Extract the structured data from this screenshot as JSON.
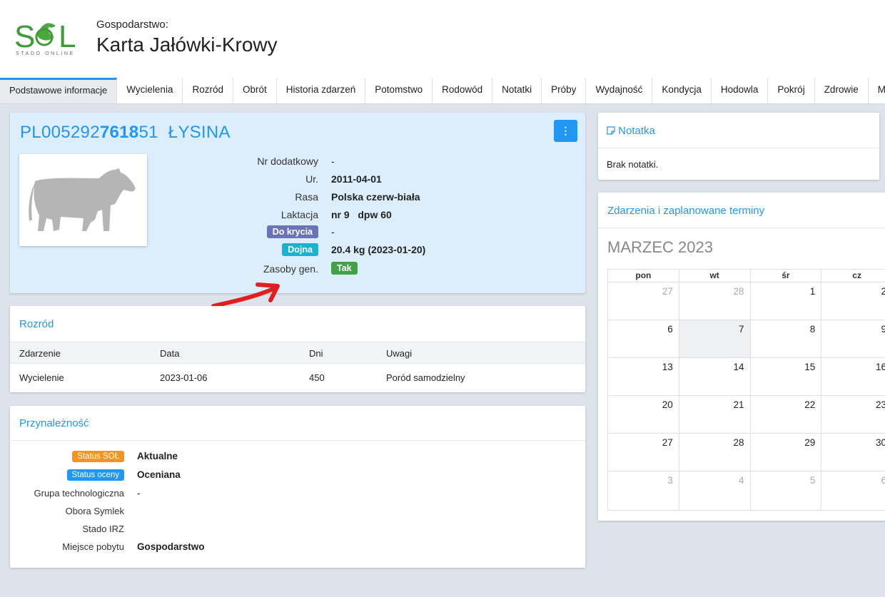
{
  "header": {
    "farm_label": "Gospodarstwo:",
    "title": "Karta Jałówki-Krowy",
    "logo_text": "STADO ONLINE",
    "logo_mark": "SOL"
  },
  "tabs": [
    "Podstawowe informacje",
    "Wycielenia",
    "Rozród",
    "Obrót",
    "Historia zdarzeń",
    "Potomstwo",
    "Rodowód",
    "Notatki",
    "Próby",
    "Wydajność",
    "Kondycja",
    "Hodowla",
    "Pokrój",
    "Zdrowie",
    "Mleko"
  ],
  "active_tab": "Podstawowe informacje",
  "cow": {
    "id_prefix": "PL005292",
    "id_bold": "7618",
    "id_suffix": "51",
    "name": "ŁYSINA",
    "menu_icon": "⋮",
    "fields": [
      {
        "label": "Nr dodatkowy",
        "value": "-"
      },
      {
        "label": "Ur.",
        "value": "2011-04-01"
      },
      {
        "label": "Rasa",
        "value": "Polska czerw-biała"
      },
      {
        "label": "Laktacja",
        "value": "nr 9   dpw 60"
      },
      {
        "label": "Do krycia",
        "value": "-",
        "badge_color": "#6b72b8"
      },
      {
        "label": "Dojna",
        "value": "20.4 kg (2023-01-20)",
        "badge_color": "#17b3d1"
      },
      {
        "label": "Zasoby gen.",
        "value": "Tak",
        "value_badge_color": "#43a047"
      }
    ]
  },
  "rozrod": {
    "title": "Rozród",
    "columns": [
      "Zdarzenie",
      "Data",
      "Dni",
      "Uwagi"
    ],
    "rows": [
      [
        "Wycielenie",
        "2023-01-06",
        "450",
        "Poród samodzielny"
      ]
    ]
  },
  "przynaleznosc": {
    "title": "Przynależność",
    "rows": [
      {
        "label": "Status SOŁ",
        "value": "Aktualne",
        "badge_color": "#f7941d"
      },
      {
        "label": "Status oceny",
        "value": "Oceniana",
        "badge_color": "#2196f3"
      },
      {
        "label": "Grupa technologiczna",
        "value": "-"
      },
      {
        "label": "Obora Symlek",
        "value": ""
      },
      {
        "label": "Stado IRZ",
        "value": ""
      },
      {
        "label": "Miejsce pobytu",
        "value": "Gospodarstwo"
      }
    ]
  },
  "notatka": {
    "title": "Notatka",
    "icon": "note-icon",
    "text": "Brak notatki."
  },
  "calendar": {
    "title": "Zdarzenia i zaplanowane terminy",
    "month": "MARZEC 2023",
    "weekdays": [
      "pon",
      "wt",
      "śr",
      "cz"
    ],
    "weeks": [
      [
        {
          "d": "27",
          "m": true
        },
        {
          "d": "28",
          "m": true
        },
        {
          "d": "1"
        },
        {
          "d": "2"
        }
      ],
      [
        {
          "d": "6"
        },
        {
          "d": "7",
          "today": true
        },
        {
          "d": "8"
        },
        {
          "d": "9"
        }
      ],
      [
        {
          "d": "13"
        },
        {
          "d": "14"
        },
        {
          "d": "15"
        },
        {
          "d": "16"
        }
      ],
      [
        {
          "d": "20"
        },
        {
          "d": "21"
        },
        {
          "d": "22"
        },
        {
          "d": "23"
        }
      ],
      [
        {
          "d": "27"
        },
        {
          "d": "28"
        },
        {
          "d": "29"
        },
        {
          "d": "30"
        }
      ],
      [
        {
          "d": "3",
          "m": true
        },
        {
          "d": "4",
          "m": true
        },
        {
          "d": "5",
          "m": true
        },
        {
          "d": "6",
          "m": true
        }
      ]
    ]
  },
  "colors": {
    "accent": "#2196f3",
    "cow_panel_bg": "#dceefb",
    "annotation_arrow": "#e02020"
  }
}
